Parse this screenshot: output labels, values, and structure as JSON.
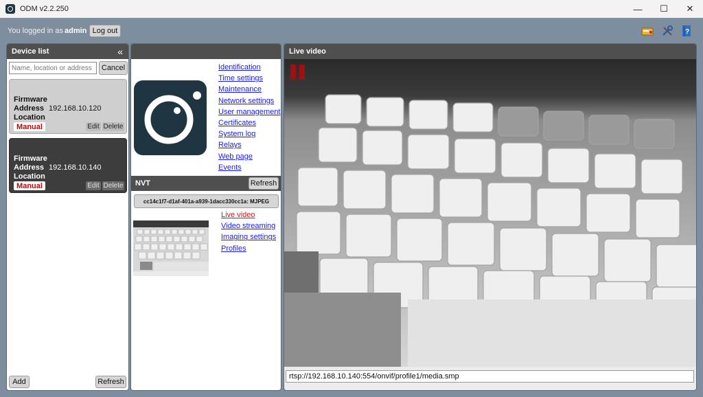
{
  "window": {
    "title": "ODM v2.2.250",
    "minimize": "—",
    "maximize": "☐",
    "close": "✕"
  },
  "topbar": {
    "login_text": "You logged in as",
    "username": "admin",
    "logout_label": "Log out",
    "icons": [
      "license-key-icon",
      "tools-icon",
      "help-book-icon"
    ]
  },
  "device_list": {
    "title": "Device list",
    "collapse_glyph": "«",
    "search_placeholder": "Name, location or address",
    "cancel_label": "Cancel",
    "devices": [
      {
        "firmware_label": "Firmware",
        "address_label": "Address",
        "address": "192.168.10.120",
        "location_label": "Location",
        "badge": "Manual",
        "edit_label": "Edit",
        "delete_label": "Delete",
        "selected": false
      },
      {
        "firmware_label": "Firmware",
        "address_label": "Address",
        "address": "192.168.10.140",
        "location_label": "Location",
        "badge": "Manual",
        "edit_label": "Edit",
        "delete_label": "Delete",
        "selected": true
      }
    ],
    "add_label": "Add",
    "refresh_label": "Refresh"
  },
  "device_panel": {
    "links": [
      "Identification",
      "Time settings",
      "Maintenance",
      "Network settings",
      "User management",
      "Certificates",
      "System log",
      "Relays",
      "Web page",
      "Events"
    ],
    "nvt_title": "NVT",
    "nvt_refresh_label": "Refresh",
    "stream_profile": "cc14c1f7-d1af-401a-a939-1dacc330cc1a: MJPEG",
    "nvt_links": [
      "Live video",
      "Video streaming",
      "Imaging settings",
      "Profiles"
    ],
    "active_nvt_link": "Live video"
  },
  "live_video": {
    "title": "Live video",
    "stream_url": "rtsp://192.168.10.140:554/onvif/profile1/media.smp",
    "pause_color": "#a01010"
  },
  "colors": {
    "background": "#7e8e9e",
    "header": "#4f4f4f",
    "selected_card": "#3d3d3d",
    "card": "#cfcfcf",
    "link": "#1a1aee",
    "active_link": "#d01818"
  }
}
